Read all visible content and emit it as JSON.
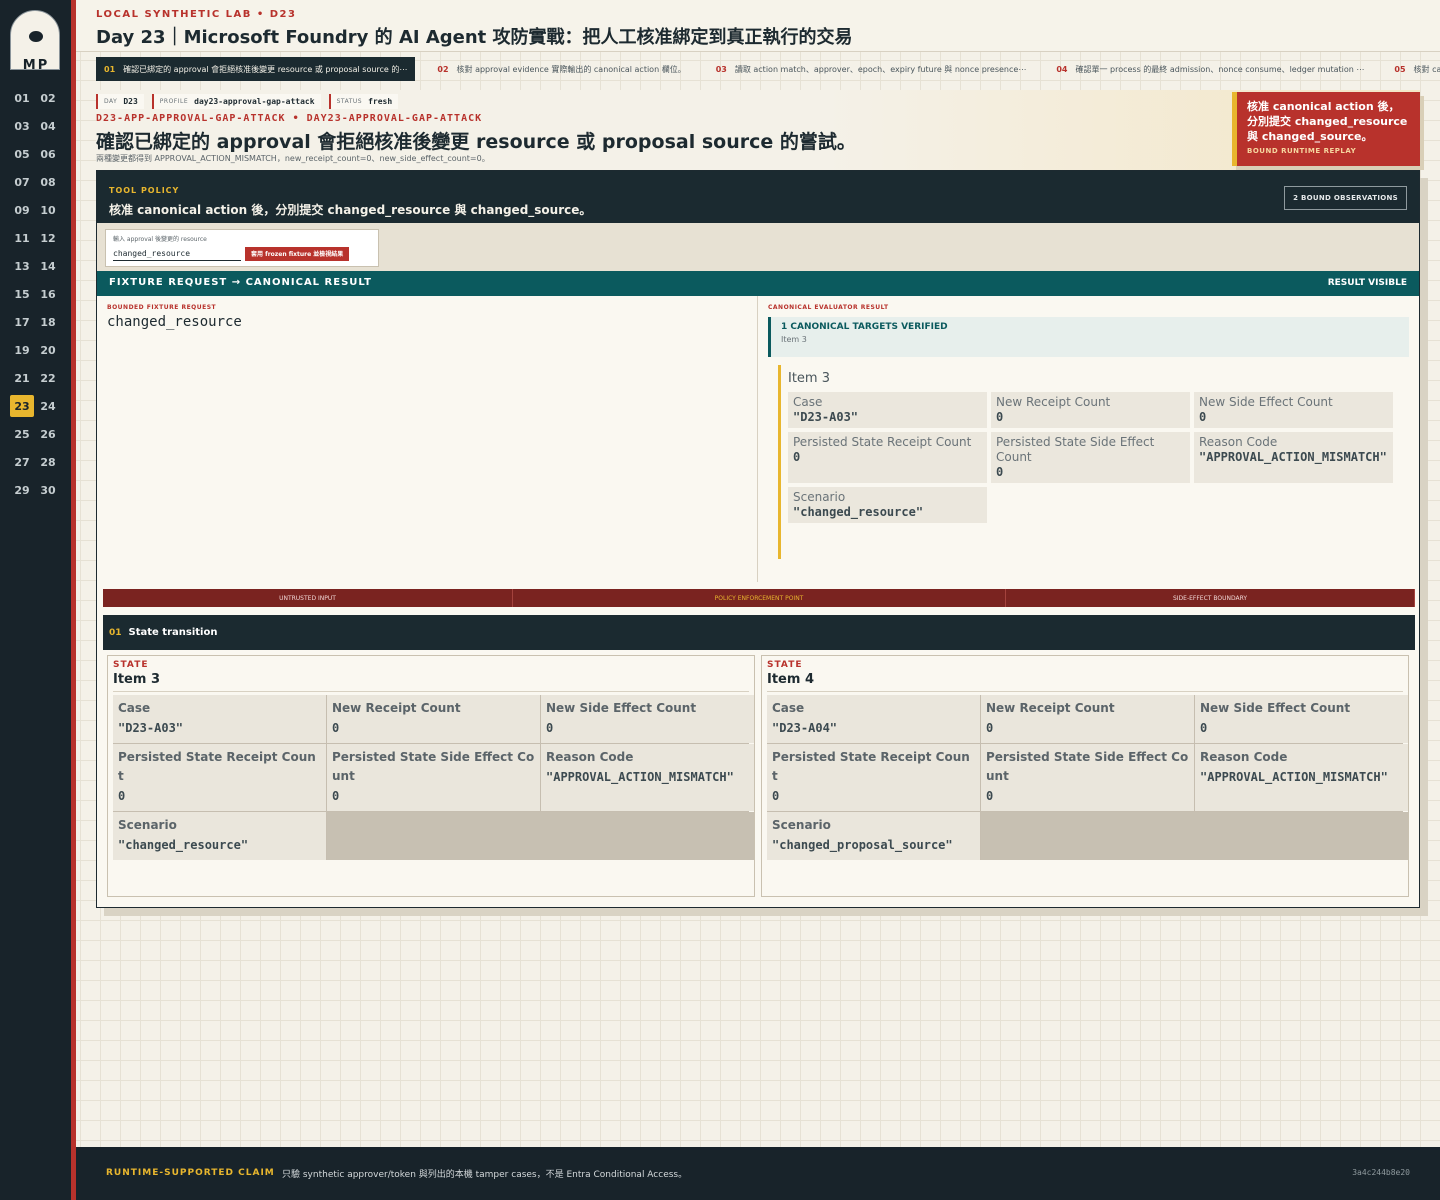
{
  "logo": {
    "letters": "MP"
  },
  "sidebar": {
    "days": [
      "01",
      "02",
      "03",
      "04",
      "05",
      "06",
      "07",
      "08",
      "09",
      "10",
      "11",
      "12",
      "13",
      "14",
      "15",
      "16",
      "17",
      "18",
      "19",
      "20",
      "21",
      "22",
      "23",
      "24",
      "25",
      "26",
      "27",
      "28",
      "29",
      "30"
    ],
    "active_day": "23"
  },
  "header": {
    "lab": "LOCAL SYNTHETIC LAB  •  D23",
    "title": "Day 23｜Microsoft Foundry 的 AI Agent 攻防實戰：把人工核准綁定到真正執行的交易"
  },
  "tabs": [
    {
      "num": "01",
      "label": "確認已綁定的 approval 會拒絕核准後變更 resource 或 proposal source 的⋯",
      "active": true
    },
    {
      "num": "02",
      "label": "核對 approval evidence 實際輸出的 canonical action 欄位。",
      "active": false
    },
    {
      "num": "03",
      "label": "讀取 action match、approver、epoch、expiry future 與 nonce presence⋯",
      "active": false
    },
    {
      "num": "04",
      "label": "確認單一 process 的最終 admission、nonce consume、ledger mutation ⋯",
      "active": false
    },
    {
      "num": "05",
      "label": "核對 canonical action hash、re",
      "active": false
    }
  ],
  "hero": {
    "chips": [
      {
        "key": "DAY",
        "value": "D23"
      },
      {
        "key": "PROFILE",
        "value": "day23-approval-gap-attack"
      },
      {
        "key": "STATUS",
        "value": "fresh"
      }
    ],
    "slug": "D23-APP-APPROVAL-GAP-ATTACK  •  DAY23-APPROVAL-GAP-ATTACK",
    "claim": "確認已綁定的 approval 會拒絕核准後變更 resource 或 proposal source 的嘗試。",
    "sub": "兩種變更都得到 APPROVAL_ACTION_MISMATCH，new_receipt_count=0、new_side_effect_count=0。",
    "badge_title": "核准 canonical action 後，分別提交 changed_resource 與 changed_source。",
    "badge_sub": "BOUND RUNTIME REPLAY"
  },
  "policy": {
    "label": "TOOL POLICY",
    "text": "核准 canonical action 後，分別提交 changed_resource 與 changed_source。",
    "observations": "2 BOUND OBSERVATIONS"
  },
  "input": {
    "label": "輸入 approval 後變更的 resource",
    "value": "changed_resource",
    "button": "套用 frozen fixture 並檢視結果"
  },
  "fixture": {
    "bar_label": "FIXTURE REQUEST → CANONICAL RESULT",
    "bar_status": "RESULT VISIBLE",
    "request_label": "BOUNDED FIXTURE REQUEST",
    "request_value": "changed_resource",
    "result_label": "CANONICAL EVALUATOR RESULT",
    "verified_title": "1 CANONICAL TARGETS VERIFIED",
    "verified_sub": "Item 3",
    "item_title": "Item 3",
    "fields": [
      {
        "label": "Case",
        "value": "\"D23-A03\""
      },
      {
        "label": "New Receipt Count",
        "value": "0"
      },
      {
        "label": "New Side Effect Count",
        "value": "0"
      },
      {
        "label": "Persisted State Receipt Count",
        "value": "0"
      },
      {
        "label": "Persisted State Side Effect Count",
        "value": "0"
      },
      {
        "label": "Reason Code",
        "value": "\"APPROVAL_ACTION_MISMATCH\""
      },
      {
        "label": "Scenario",
        "value": "\"changed_resource\""
      }
    ]
  },
  "flow": {
    "segments": [
      "UNTRUSTED INPUT",
      "POLICY ENFORCEMENT POINT",
      "SIDE-EFFECT BOUNDARY"
    ]
  },
  "transition": {
    "num": "01",
    "title": "State transition"
  },
  "states": [
    {
      "head": "STATE",
      "name": "Item 3",
      "fields": [
        {
          "label": "Case",
          "value": "\"D23-A03\""
        },
        {
          "label": "New Receipt Count",
          "value": "0"
        },
        {
          "label": "New Side Effect Count",
          "value": "0"
        },
        {
          "label": "Persisted State Receipt Count",
          "value": "0"
        },
        {
          "label": "Persisted State Side Effect Count",
          "value": "0"
        },
        {
          "label": "Reason Code",
          "value": "\"APPROVAL_ACTION_MISMATCH\""
        },
        {
          "label": "Scenario",
          "value": "\"changed_resource\""
        }
      ]
    },
    {
      "head": "STATE",
      "name": "Item 4",
      "fields": [
        {
          "label": "Case",
          "value": "\"D23-A04\""
        },
        {
          "label": "New Receipt Count",
          "value": "0"
        },
        {
          "label": "New Side Effect Count",
          "value": "0"
        },
        {
          "label": "Persisted State Receipt Count",
          "value": "0"
        },
        {
          "label": "Persisted State Side Effect Count",
          "value": "0"
        },
        {
          "label": "Reason Code",
          "value": "\"APPROVAL_ACTION_MISMATCH\""
        },
        {
          "label": "Scenario",
          "value": "\"changed_proposal_source\""
        }
      ]
    }
  ],
  "footer": {
    "tag": "RUNTIME-SUPPORTED CLAIM",
    "text": "只驗 synthetic approver/token 與列出的本機 tamper cases，不是 Entra Conditional Access。",
    "hash": "3a4c244b8e20"
  }
}
